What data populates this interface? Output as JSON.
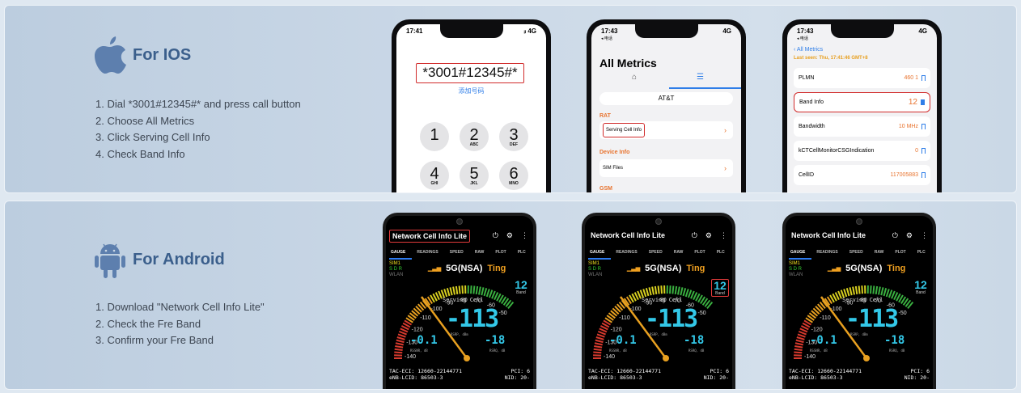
{
  "ios": {
    "title": "For IOS",
    "steps": [
      "1. Dial *3001#12345#* and press call button",
      "2. Choose All Metrics",
      "3. Click Serving Cell Info",
      "4. Check Band Info"
    ],
    "phone1": {
      "time": "17:41",
      "status": "ᵢₗ 4G",
      "dial": "*3001#12345#*",
      "add": "添加号码",
      "keys": [
        {
          "d": "1",
          "l": ""
        },
        {
          "d": "2",
          "l": "ABC"
        },
        {
          "d": "3",
          "l": "DEF"
        },
        {
          "d": "4",
          "l": "GHI"
        },
        {
          "d": "5",
          "l": "JKL"
        },
        {
          "d": "6",
          "l": "MNO"
        }
      ]
    },
    "phone2": {
      "time": "17:43",
      "back": "◂ 电话",
      "status": "4G",
      "title": "All Metrics",
      "carrier": "AT&T",
      "rat": "RAT",
      "serving": "Serving Cell Info",
      "device": "Device Info",
      "sim": "SIM Files",
      "gsm": "GSM"
    },
    "phone3": {
      "time": "17:43",
      "back": "◂ 电话",
      "status": "4G",
      "nav": "All Metrics",
      "lastseen": "Last seen: Thu, 17:41:46 GMT+8",
      "rows": [
        {
          "k": "PLMN",
          "v": "460 1"
        },
        {
          "k": "Band Info",
          "v": "12"
        },
        {
          "k": "Bandwidth",
          "v": "10 MHz"
        },
        {
          "k": "kCTCellMonitorCSGIndication",
          "v": "0"
        },
        {
          "k": "CellID",
          "v": "117005883"
        }
      ]
    }
  },
  "android": {
    "title": "For Android",
    "steps": [
      "1. Download \"Network Cell Info Lite\"",
      "2. Check the Fre Band",
      "3. Confirm your Fre Band"
    ],
    "app": {
      "title": "Network Cell Info Lite",
      "tabs": [
        "GAUGE",
        "READINGS",
        "SPEED",
        "RAW",
        "PLOT",
        "PLC"
      ],
      "sim": "SIM1",
      "sdr": "S D R",
      "wlan": "WLAN",
      "net": "5G(NSA)",
      "carrier": "Ting",
      "band": "12",
      "band_label": "Band",
      "serving": "Serving Cell",
      "rsrp": "-113",
      "rsrp_unit": "RSRP, dBm",
      "rssnr": "-0.1",
      "rssnr_unit": "RSSNR, dB",
      "rsrq": "-18",
      "rsrq_unit": "RSRQ, dB",
      "ticks": [
        "-140",
        "-130",
        "-120",
        "-110",
        "-100",
        "-90",
        "-80",
        "-70",
        "-60",
        "-50"
      ],
      "tac": "TAC-ECI: 12660-22144771",
      "pci": "PCI: 6",
      "enb": "eNB-LCID: 86503-3",
      "nid": "NID: 20-"
    }
  }
}
